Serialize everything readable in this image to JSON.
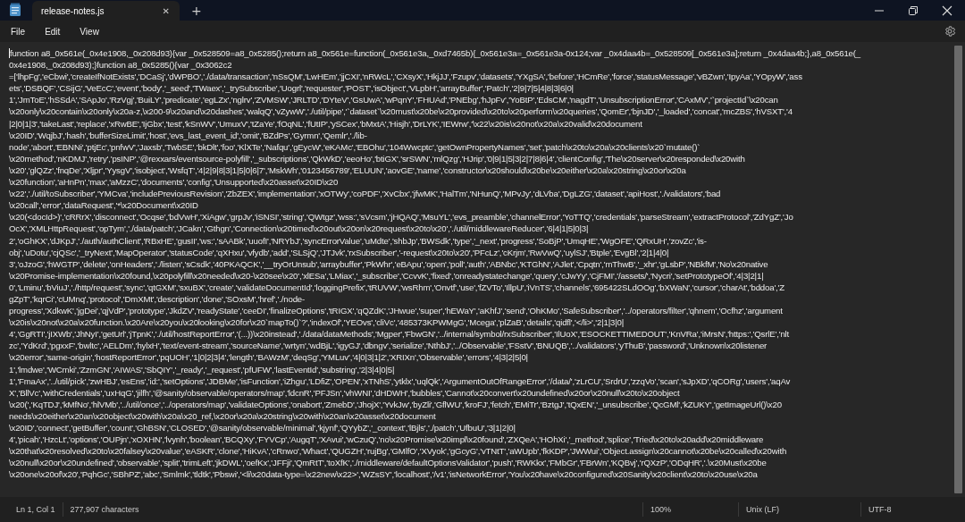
{
  "tab": {
    "title": "release-notes.js",
    "close": "✕",
    "new_tab": "+",
    "selected": true
  },
  "menu": [
    "File",
    "Edit",
    "View"
  ],
  "editor": {
    "lines": [
      "function a8_0x561e(_0x4e1908,_0x208d93){var _0x528509=a8_0x5285();return a8_0x561e=function(_0x561e3a,_0xd7465b){_0x561e3a=_0x561e3a-0x124;var _0x4daa4b=_0x528509[_0x561e3a];return _0x4daa4b;},a8_0x561e(_",
      "0x4e1908,_0x208d93);}function a8_0x5285(){var _0x3062c2",
      "=['lhpFg','eCbwi','createIfNotExists','DCaSj','dWPBO','./data/transaction','nSsQM','LwHEm','jjCXI','nRWcL','CXsyX','HkjJJ','Fzupv','datasets','YXgSA','before','HCmRe','force','statusMessage','vBZwn','IpyAa','YOpyW','ass",
      "ets','DSBQF','CSijG','VeEcC','event','body','_seed','TWaex','_trySubscribe','Uogrl','requester','POST','isObject','VLpbH','arrayBuffer','Patch','2|9|7|5|4|8|3|6|0|",
      "1','JmToE','hSSdA','SApJo','RzVgj','BuiLY','predicate','egLZx','nglrv','ZVMSW','JRLTD','DYteV','GsUwA','wPqnY','FHUAd','PNEbg','hJpFv','YoBtP','EdsCM','nagdT','UnsubscriptionError','CAxMV','`projectId`\\x20can",
      "\\x20only\\x20contain\\x20only\\x20a-z,\\x200-9\\x20and\\x20dashes','walqQ','vZywW','./util/pipe','`dataset`\\x20must\\x20be\\x20provided\\x20to\\x20perform\\x20queries','QomEr','bjnJD','_loaded','concat','mcZBS','hVSXT','4",
      "|2|0|1|3','takeLast','replace','xRwBE','IjGbx','test','kSnWV','UmuxV','tZaYe','fOqNL','fUtIP','ySCex','bMxtA','Hisjh','DrLYK','IEWrw','\\x22\\x20is\\x20not\\x20a\\x20valid\\x20document",
      "\\x20ID','WqjbJ','hash','bufferSizeLimit','host','evs_last_event_id','omit','BZdPs','Gyrmn','Qemlr','./lib-",
      "node','abort','EBNNi','ptjEc','pnfwV','Jaxsb','TwbSE','bkDlt','foo','KlXTe','Nafqu','gEycW','eKAMc','EBOhu','104Wwcptc','getOwnPropertyNames','set','patch\\x20to\\x20a\\x20clients\\x20`mutate()`",
      "\\x20method','nKDMJ','retry','psINP','@rexxars/eventsource-polyfill','_subscriptions','QkWkD','eeoHo','btiGX','srSWN','mlQzg','HJrip','0|9|1|5|3|2|7|8|6|4','clientConfig','The\\x20server\\x20responded\\x20with",
      "\\x20','glQZz','fnqDe','Xljpr','YysgV','isobject','WsfqT','4|2|9|8|3|1|5|0|6|7','MskWh','0123456789','ELUUN','aovGE','name','constructor\\x20should\\x20be\\x20either\\x20a\\x20string\\x20or\\x20a",
      "\\x20function','aHnPn','max','aMzzC','documents','config','Unsupported\\x20asset\\x20ID\\x20",
      "\\x22','./util/toSubscriber','YMCva','includePreviousRevision','ZbZEX','implementation','xOTWy','coPDF','XvCbx','jfwMK','HalTm','NHunQ','MPvJy','dLVba','DgLZG','dataset','apiHost','./validators','bad",
      "\\x20call','error','dataRequest','*\\x20Document\\x20ID",
      "\\x20(<docId>)','cRRrX','disconnect','Ocqse','bdVwH','XiAgw','grpJv','iSNSI','string','QWtgz','wss:','sVcsm','jHQAQ','MsuYL','evs_preamble','channelError','YoTTQ','credentials','parseStream','extractProtocol','ZdYgZ','Jo",
      "OcX','XMLHttpRequest','opTym','./data/patch','JCakn','Gthgn','Connection\\x20timed\\x20out\\x20on\\x20request\\x20to\\x20','./util/middlewareReducer','6|4|1|5|0|3|",
      "2','oGhKX','dJKpJ','./auth/authClient','RBxHE','gusII','ws:','sAABk','uuofI','NRYbJ','syncErrorValue','uMdte','shbJp','BWSdk','type','_next','progress','SoBjP','UmqHE','WgOFE','QRxUH','zovZc','is-",
      "obj','uDotu','cjQSc','_tryNext','MapOperator','statusCode','qXHxu','vfydb','add','SLSjQ','JTJvk','rxSubscriber','-request\\x20to\\x20','PFcLz','cKrjm','RwVwQ','uylSJ','Btple','EvgBl','2|1|4|0|",
      "3','oJzoG','hWGTP','delete','onHeaders','./listen','sCsdk','40PKAQCK','__tryOrUnsub','arraybuffer','PkWhr','eBApu','open','poll','auth','ABNbc','KTGhN','AJlet','Cpqtn','mThwB','_xhr','gLsbP','NBkfM','No\\x20native",
      "\\x20Promise-implementation\\x20found,\\x20polyfill\\x20needed\\x20-\\x20see\\x20','xlESa','LMiax','_subscribe','CcvvK','fixed','onreadystatechange','query','cJwYy','CjFMI','/assets/','Nycri','setPrototypeOf','4|3|2|1|",
      "0','Lminu','bViuJ','./http/request','sync','qtGXM','sxuBX','create','validateDocumentId','loggingPrefix','tRUVW','wsRhm','Onvtf','use','fZVTo','IllpU','iVnTS','channels','695422SLdOOg','bXWaN','cursor','charAt','bddoa','Z",
      "gZpT','kqrCi','cUMnq','protocol','DmXMt','description','done','SOxsM','href','./node-",
      "progress','XdkwK','jgDei','qjVdP','prototype','JkdZV','readyState','ceeDI','finalizeOptions','tRIGX','qQZdK','JHwue','super','hEWaY','aKhfJ','send','OhKMo','SafeSubscriber','../operators/filter','qhnem','Ocfhz','argument",
      "\\x20is\\x20not\\x20a\\x20function.\\x20Are\\x20you\\x20looking\\x20for\\x20`mapTo()`?','indexOf','YEOvs','cliVc','485373KPWMgG','Mcega','plZaB','details','qidfl','</li>','2|1|3|0|",
      "4','GgRTI','jIXWb','JhNyI','getUrl','jTpnK','./util/hostReportError','(...))\\x20instead','./data/dataMethods','Mgper','FbwGN','../internal/symbol/rxSubscriber','IlUoX','ESOCKETTIMEDOUT','KnVRa','iMrsN','https:','QsrlE','nlt",
      "zc','YdKrd','pgxxF','bwltc','AELDm','hylxH','text/event-stream','sourceName','wrtyn','wdBjL','igyGJ','dbngv','serialize','NthbJ','../Observable','FSstV','BNUQB','../validators','yThuB','password','Unknown\\x20listener",
      "\\x20error','same-origin','hostReportError','pqUOH','1|0|2|3|4','length','BAWzM','deqSg','YMLuv','4|0|3|1|2','XRIXn','Observable','errors','4|3|2|5|0|",
      "1','lmdwe','WCmki','ZzmGN','AIWAS','SbQIY','_ready','_request','pfUFW','lastEventId','substring','2|3|4|0|5|",
      "1','FmaAx','../util/pick','zwHBJ','esEns','id:','setOptions','JDBMe','isFunction','iZhgu','LDfiZ','OPEN','xTNhS','ytklx','uqlQk','ArgumentOutOfRangeError','/data/','zLrCU','SrdrU','zzqVo','scan','sJpXD','qCORg','users','aqAv",
      "X','BllVc','withCredentials','uxHqG','jilfh','@sanity/observable/operators/map','ldcnR','PFJSn','vhWNI','dHDWH','bubbles','Cannot\\x20convert\\x20undefined\\x20or\\x20null\\x20to\\x20object",
      "\\x20(','KqTDJ','kMfNo','hlVMb','../util/once','../operators/map','validateOptions','onabort','ZmebD','JhojX','YvkJw','byZli','GflWU','kroFJ','fetch','EMiTr','BztgJ','tQxEN','_unsubscribe','QcGMl','kZUKY','getImageUrl()\\x20",
      "needs\\x20either\\x20an\\x20object\\x20with\\x20a\\x20_ref,\\x20or\\x20a\\x20string\\x20with\\x20an\\x20asset\\x20document",
      "\\x20ID','connect','getBuffer','count','GhBSN','CLOSED','@sanity/observable/minimal','kjynf','QYybZ','_context','lBjls','./patch','UfbuU','3|1|2|0|",
      "4','picah','HzcLt','options','OUPjn','xOXHN','lvynh','boolean','BCQXy','FYVCp','AugqT','XAvui','wCzuQ','no\\x20Promise\\x20impl\\x20found','ZXQeA','HOhXi','_method','splice','Tried\\x20to\\x20add\\x20middleware",
      "\\x20that\\x20resolved\\x20to\\x20falsey\\x20value','eASKR','clone','HiKvA','cRnwo','Whact','QUGZH','rujBg','GMlfO','XVyok','gGcyG','vTNtT','aWUpb','fkKDP','JWWui','Object.assign\\x20cannot\\x20be\\x20called\\x20with",
      "\\x20null\\x20or\\x20undefined','observable','split','trimLeft','jkDWL','oefKx','JFFji','QmRtT','toXfK','./middleware/defaultOptionsValidator','push','RWKkx','FMbGr','FBrWn','KQBvj','rQXzP','ODqHR','.\\x20Must\\x20be",
      "\\x20one\\x20of\\x20','PqhGc','SBhPZ','abc','Smlmk','tldtk','Pbswi','<li\\x20data-type=\\x22new\\x22>','WZsSY','localhost','/v1','isNetworkError','You\\x20have\\x20configured\\x20Sanity\\x20client\\x20to\\x20use\\x20a"
    ]
  },
  "status_bar": {
    "position": "Ln 1, Col 1",
    "characters": "277,907 characters",
    "zoom": "100%",
    "line_ending": "Unix (LF)",
    "encoding": "UTF-8"
  }
}
